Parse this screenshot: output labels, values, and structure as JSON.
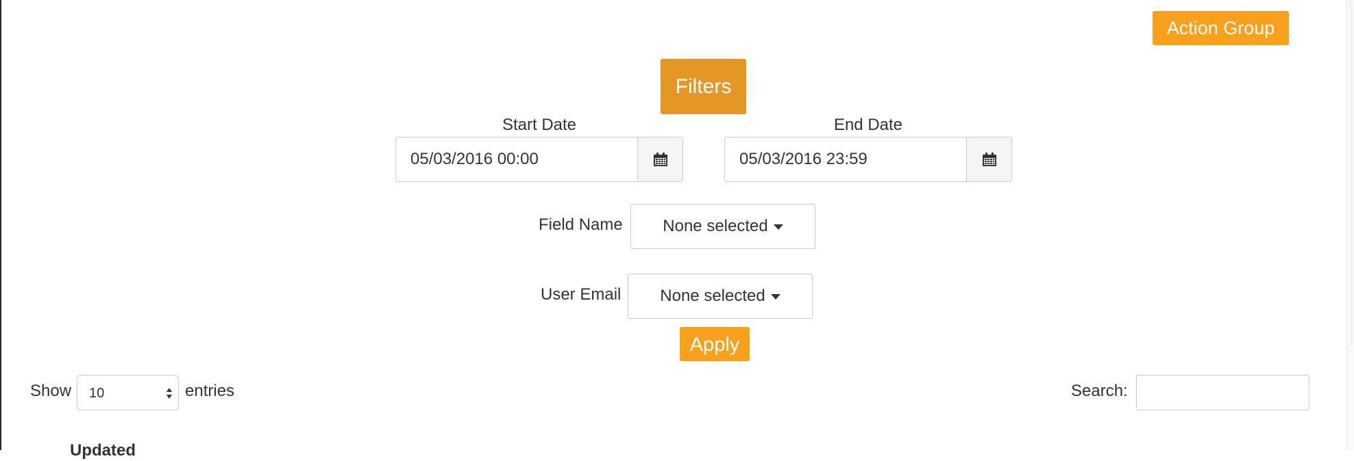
{
  "toolbar": {
    "action_group_label": "Action Group"
  },
  "filters": {
    "title": "Filters",
    "start_date": {
      "label": "Start Date",
      "value": "05/03/2016 00:00"
    },
    "end_date": {
      "label": "End Date",
      "value": "05/03/2016 23:59"
    },
    "field_name": {
      "label": "Field Name",
      "selected": "None selected"
    },
    "user_email": {
      "label": "User Email",
      "selected": "None selected"
    },
    "apply_label": "Apply"
  },
  "table_controls": {
    "show_label": "Show",
    "entries_value": "10",
    "entries_label": "entries",
    "search_label": "Search:",
    "search_value": ""
  },
  "table": {
    "columns": [
      "Updated"
    ]
  },
  "colors": {
    "accent": "#f9a01c",
    "filters_button": "#e49724"
  },
  "icons": {
    "date_picker": "calendar-icon",
    "dropdown": "caret-down-icon"
  }
}
